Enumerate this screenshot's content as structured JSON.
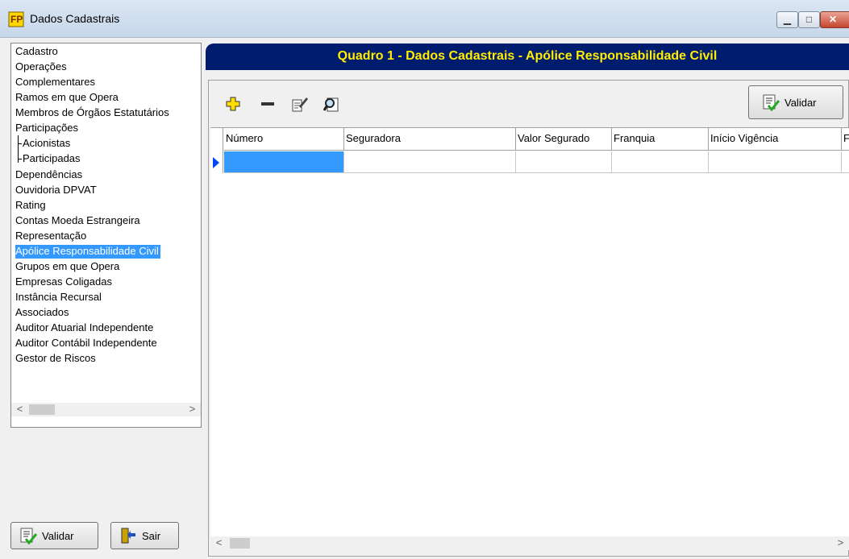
{
  "window": {
    "title": "Dados Cadastrais"
  },
  "tree": {
    "items": [
      {
        "label": "Cadastro"
      },
      {
        "label": "Operações"
      },
      {
        "label": "Complementares"
      },
      {
        "label": "Ramos em que Opera"
      },
      {
        "label": "Membros de Órgãos Estatutários"
      },
      {
        "label": "Participações"
      },
      {
        "label": "Acionistas"
      },
      {
        "label": "Participadas"
      },
      {
        "label": "Dependências"
      },
      {
        "label": "Ouvidoria DPVAT"
      },
      {
        "label": "Rating"
      },
      {
        "label": "Contas Moeda Estrangeira"
      },
      {
        "label": "Representação"
      },
      {
        "label": "Apólice Responsabilidade Civil"
      },
      {
        "label": "Grupos em que Opera"
      },
      {
        "label": "Empresas Coligadas"
      },
      {
        "label": "Instância Recursal"
      },
      {
        "label": "Associados"
      },
      {
        "label": "Auditor Atuarial Independente"
      },
      {
        "label": "Auditor Contábil Independente"
      },
      {
        "label": "Gestor de Riscos"
      }
    ],
    "selected": "Apólice Responsabilidade Civil"
  },
  "left_buttons": {
    "validar": "Validar",
    "sair": "Sair"
  },
  "header": {
    "title": "Quadro 1 - Dados Cadastrais - Apólice Responsabilidade Civil"
  },
  "toolbar": {
    "validar": "Validar",
    "icons": [
      "add-icon",
      "remove-icon",
      "edit-icon",
      "search-icon"
    ]
  },
  "grid": {
    "columns": [
      "Número",
      "Seguradora",
      "Valor Segurado",
      "Franquia",
      "Início Vigência",
      "F"
    ]
  },
  "colors": {
    "header_bg": "#001c6e",
    "header_text": "#ffee00",
    "selection": "#3399ff"
  }
}
